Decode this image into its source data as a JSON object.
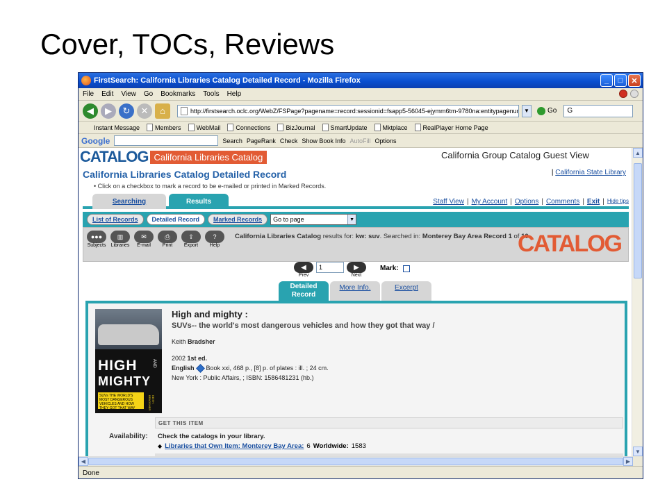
{
  "slide": {
    "title": "Cover, TOCs, Reviews"
  },
  "window": {
    "title": "FirstSearch: California Libraries Catalog Detailed Record - Mozilla Firefox"
  },
  "menu": [
    "File",
    "Edit",
    "View",
    "Go",
    "Bookmarks",
    "Tools",
    "Help"
  ],
  "nav": {
    "url": "http://firstsearch.oclc.org/WebZ/FSPage?pagename=record:sessionid=fsapp5-56045-ejymm6tm-9780na:entitypagenum=",
    "go_label": "Go",
    "search_prefix": "G"
  },
  "bookmarks": [
    "Instant Message",
    "Members",
    "WebMail",
    "Connections",
    "BizJournal",
    "SmartUpdate",
    "Mktplace",
    "RealPlayer Home Page"
  ],
  "google_bar": {
    "logo": "Google",
    "search": "Search",
    "pagerank": "PageRank",
    "check": "Check",
    "showbookinfo": "Show Book Info",
    "autofill": "AutoFill",
    "options": "Options"
  },
  "page": {
    "logo_big": "CATALOG",
    "logo_tag": "California Libraries Catalog",
    "guest_view": "California Group Catalog Guest View",
    "heading": "California Libraries Catalog Detailed Record",
    "state_library_sep": "|",
    "state_library": "California State Library",
    "hint": "• Click on a checkbox to mark a record to be e-mailed or printed in Marked Records.",
    "tabs": {
      "searching": "Searching",
      "results": "Results"
    },
    "toplinks": [
      "Staff View",
      "My Account",
      "Options",
      "Comments",
      "Exit",
      "Hide tips"
    ],
    "subtabs": [
      "List of Records",
      "Detailed Record",
      "Marked Records"
    ],
    "goto_page": "Go to page",
    "tools": [
      {
        "label": "Subjects",
        "glyph": "●●●"
      },
      {
        "label": "Libraries",
        "glyph": "▥"
      },
      {
        "label": "E-mail",
        "glyph": "✉"
      },
      {
        "label": "Print",
        "glyph": "⎙"
      },
      {
        "label": "Export",
        "glyph": "⇪"
      },
      {
        "label": "Help",
        "glyph": "?"
      }
    ],
    "results_info": {
      "catalog": "California Libraries Catalog",
      "results_for": "results for:",
      "query": "kw: suv",
      "searched_in": ". Searched in:",
      "area": "Monterey Bay Area",
      "record_label": "Record",
      "record_num": "1",
      "of_label": "of",
      "total": "10"
    },
    "catalog_logo2": "CATALOG",
    "recnav": {
      "prev": "Prev",
      "next": "Next",
      "record_num": "1",
      "mark": "Mark:"
    },
    "rectabs": {
      "detail_line1": "Detailed",
      "detail_line2": "Record",
      "more": "More Info.",
      "excerpt": "Excerpt"
    },
    "cover": {
      "line1": "HIGH",
      "line2": "MIGHTY",
      "and": "AND",
      "suv": "SUVs THE WORLD'S MOST DANGEROUS VEHICLES AND HOW THEY GOT THAT WAY",
      "author": "KEITH BRADSHER"
    },
    "record": {
      "title": "High and mighty :",
      "subtitle": "SUVs-- the world's most dangerous vehicles and how they got that way /",
      "author_first": "Keith",
      "author_last": "Bradsher",
      "year": "2002",
      "edition": "1st ed.",
      "language": "English",
      "desc": "Book xxi, 468 p., [8] p. of plates : ill. ; 24 cm.",
      "pub": "New York : Public Affairs, ; ISBN: 1586481231 (hb.)"
    },
    "get_item": "GET THIS ITEM",
    "availability_label": "Availability:",
    "availability_value": "Check the catalogs in your library.",
    "libraries_link": "Libraries that Own Item: Monterey Bay Area:",
    "libraries_count": "6",
    "worldwide_label": "Worldwide:",
    "worldwide_count": "1583"
  },
  "status": "Done"
}
